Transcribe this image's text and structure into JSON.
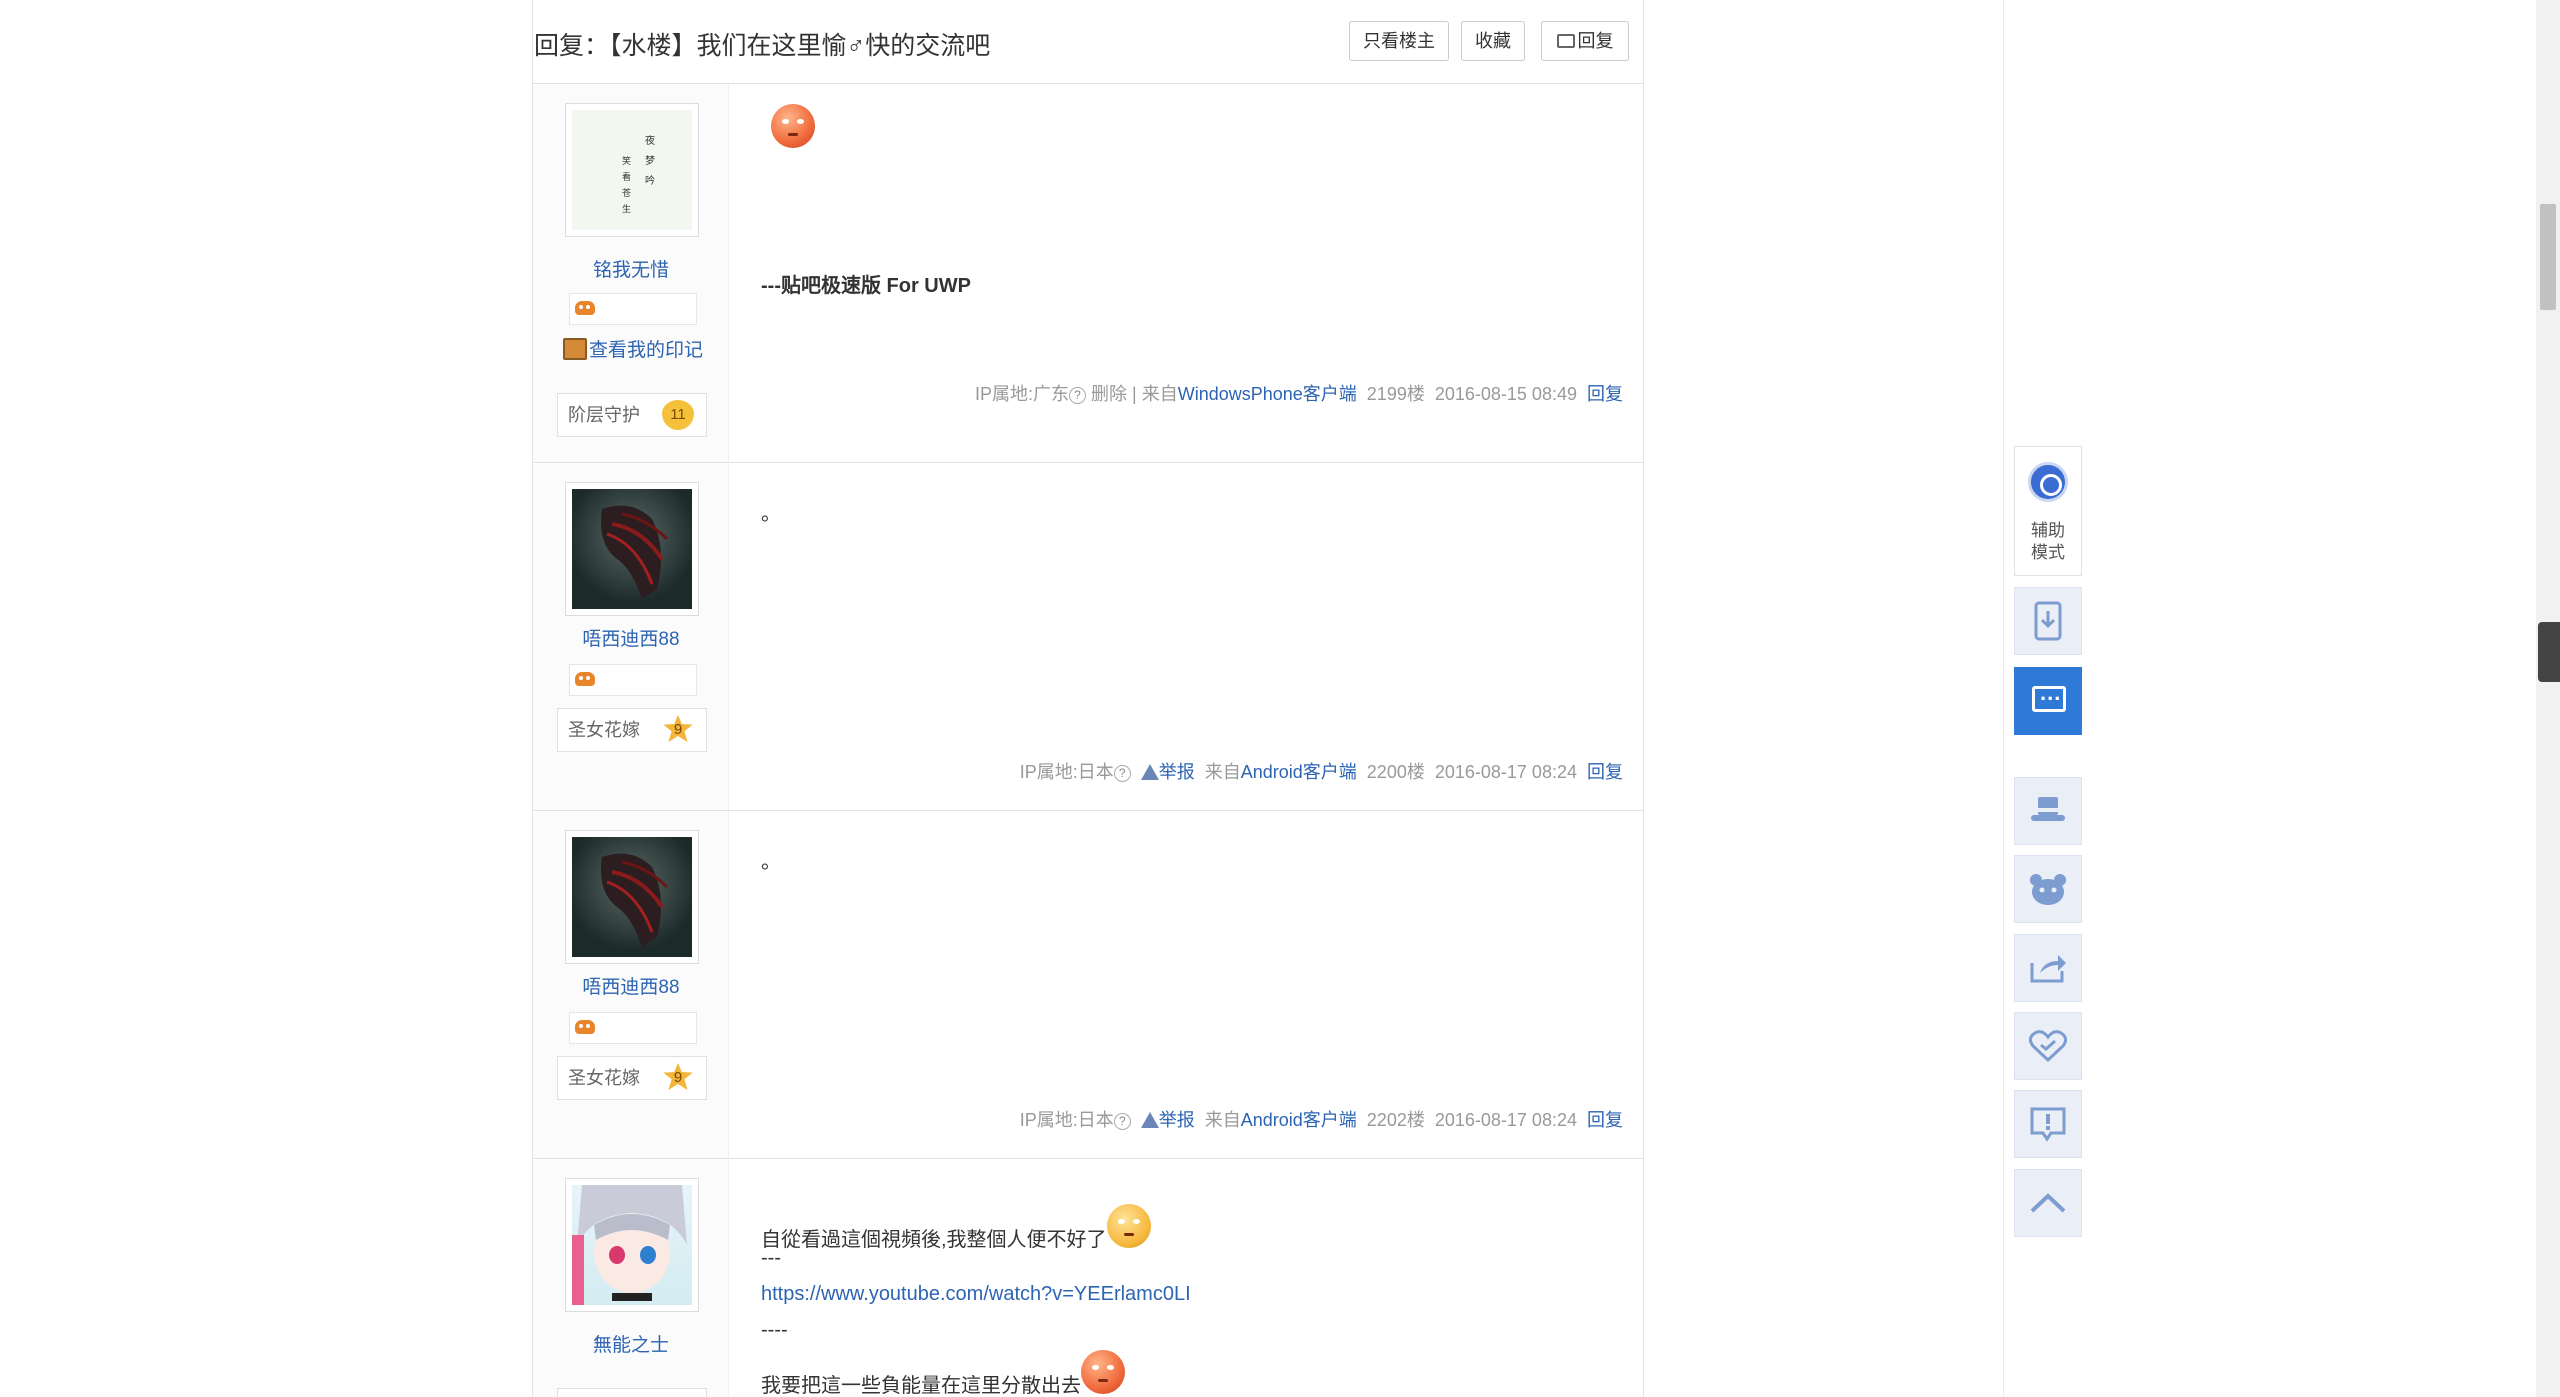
{
  "thread": {
    "title": "回复：【水楼】我们在这里愉♂快的交流吧",
    "buttons": {
      "only_op": "只看楼主",
      "favorite": "收藏",
      "reply": "回复"
    }
  },
  "posts": [
    {
      "username": "铭我无惜",
      "avatar_text": "夜梦吟 笑看苍生",
      "diary_link": "查看我的印记",
      "rank_title": "阶层守护",
      "level": "11",
      "content": "---贴吧极速版 For UWP",
      "meta": {
        "ip": "IP属地:广东",
        "action": "删除 | 来自",
        "client": "WindowsPhone客户端",
        "floor": "2199楼",
        "time": "2016-08-15 08:49",
        "reply": "回复"
      }
    },
    {
      "username": "唔西迪西88",
      "rank_title": "圣女花嫁",
      "level": "9",
      "content": "。",
      "meta": {
        "ip": "IP属地:日本",
        "report": "举报",
        "from": "来自",
        "client": "Android客户端",
        "floor": "2200楼",
        "time": "2016-08-17 08:24",
        "reply": "回复"
      }
    },
    {
      "username": "唔西迪西88",
      "rank_title": "圣女花嫁",
      "level": "9",
      "content": "。",
      "meta": {
        "ip": "IP属地:日本",
        "report": "举报",
        "from": "来自",
        "client": "Android客户端",
        "floor": "2202楼",
        "time": "2016-08-17 08:24",
        "reply": "回复"
      }
    },
    {
      "username": "無能之士",
      "content_lines": [
        "自從看過這個視頻後,我整個人便不好了",
        "---",
        "https://www.youtube.com/watch?v=YEErlamc0LI",
        "----",
        "我要把這一些負能量在這里分散出去"
      ]
    }
  ],
  "toolbar": {
    "assist_label_1": "辅助",
    "assist_label_2": "模式"
  },
  "colors": {
    "link": "#2d64b3",
    "accent": "#2e7ad6",
    "toolbar_bg": "#e9eef7"
  }
}
